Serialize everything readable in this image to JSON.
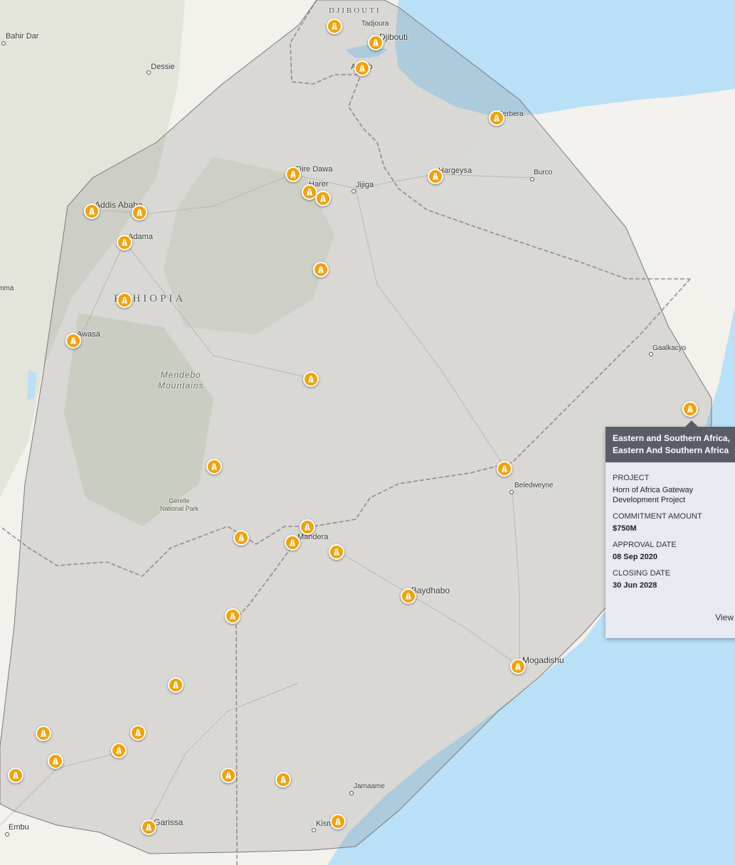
{
  "map": {
    "country_labels": {
      "djibouti": "DJIBOUTI",
      "ethiopia": "ETHIOPIA"
    },
    "region_labels": {
      "mendebo": "Mendebo\nMountains",
      "gerelle": "Gerelle\nNational Park"
    },
    "cities": {
      "bahir_dar": "Bahir Dar",
      "dessie": "Dessie",
      "tadjoura": "Tadjoura",
      "djibouti": "Djibouti",
      "assab": "Assab",
      "berbera": "Berbera",
      "dire_dawa": "Dire Dawa",
      "harer": "Harer",
      "jijiga": "Jijiga",
      "hargeysa": "Hargeysa",
      "burco": "Burco",
      "addis_ababa": "Addis Ababa",
      "adama": "Adama",
      "jimma": "Jimma",
      "awasa": "Awasa",
      "gaalkacyo": "Gaalkacyo",
      "beledweyne": "Beledweyne",
      "mandera": "Mandera",
      "baydhabo": "Baydhabo",
      "mogadishu": "Mogadishu",
      "jamaame": "Jamaame",
      "kismayo": "Kismayo",
      "garissa": "Garissa",
      "embu": "Embu"
    },
    "marker_icon": "road-construction-icon",
    "colors": {
      "marker_fill": "#f0a30a",
      "polygon_fill": "#808080",
      "water": "#b9e0f7",
      "popup_header": "#595d68"
    }
  },
  "popup": {
    "title": "Eastern and Southern Africa, Eastern And Southern Africa",
    "project_label": "PROJECT",
    "project_value": "Horn of Africa Gateway Development Project",
    "commitment_label": "COMMITMENT AMOUNT",
    "commitment_value": "$750M",
    "approval_label": "APPROVAL DATE",
    "approval_value": "08 Sep 2020",
    "closing_label": "CLOSING DATE",
    "closing_value": "30 Jun 2028",
    "view_label": "View"
  }
}
